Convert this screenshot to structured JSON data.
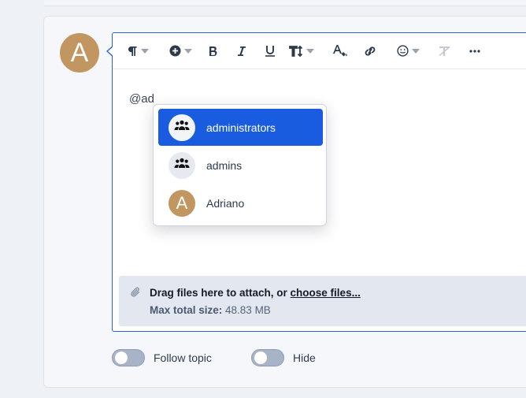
{
  "author": {
    "initial": "A",
    "color": "#c29660"
  },
  "toolbar": {
    "items": [
      {
        "name": "paragraph-icon",
        "dropdown": true
      },
      {
        "name": "insert-plus-icon",
        "dropdown": true
      },
      {
        "name": "bold-icon",
        "dropdown": false
      },
      {
        "name": "italic-icon",
        "dropdown": false
      },
      {
        "name": "underline-icon",
        "dropdown": false
      },
      {
        "name": "text-size-icon",
        "dropdown": true
      },
      {
        "name": "text-color-icon",
        "dropdown": false
      },
      {
        "name": "link-icon",
        "dropdown": false
      },
      {
        "name": "emoji-icon",
        "dropdown": true
      },
      {
        "name": "clear-format-icon",
        "dropdown": false
      },
      {
        "name": "more-icon",
        "dropdown": false
      }
    ]
  },
  "editor": {
    "text": "@ad"
  },
  "mentions": [
    {
      "label": "administrators",
      "type": "group",
      "active": true
    },
    {
      "label": "admins",
      "type": "group",
      "active": false
    },
    {
      "label": "Adriano",
      "type": "user",
      "initial": "A",
      "active": false
    }
  ],
  "attach": {
    "drag_text": "Drag files here to attach, or ",
    "choose_link": "choose files...",
    "max_label": "Max total size:",
    "max_value": " 48.83 MB"
  },
  "toggles": {
    "follow_label": "Follow topic",
    "hide_label": "Hide"
  },
  "colors": {
    "accent": "#1a5ce0",
    "border": "#2a62c9"
  }
}
